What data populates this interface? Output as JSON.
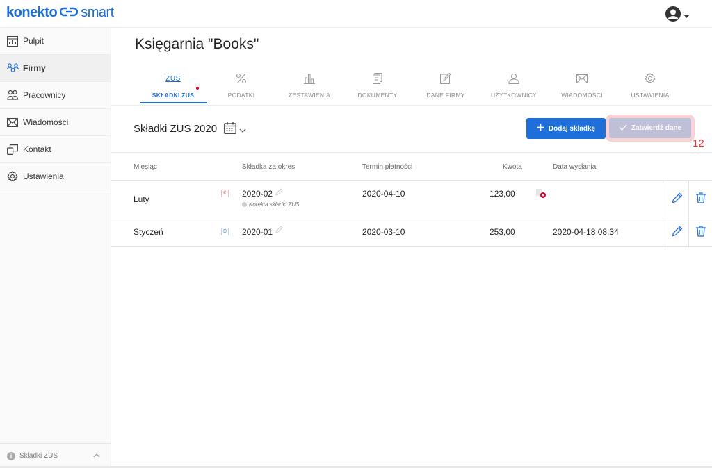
{
  "app": {
    "logo_main": "konekto",
    "logo_sub": "smart"
  },
  "sidebar": {
    "items": [
      {
        "label": "Pulpit",
        "icon": "dashboard-icon"
      },
      {
        "label": "Firmy",
        "icon": "companies-icon",
        "active": true
      },
      {
        "label": "Pracownicy",
        "icon": "employees-icon"
      },
      {
        "label": "Wiadomości",
        "icon": "mail-icon"
      },
      {
        "label": "Kontakt",
        "icon": "contact-icon"
      },
      {
        "label": "Ustawienia",
        "icon": "gear-icon"
      }
    ],
    "footer": "Składki ZUS"
  },
  "page": {
    "title": "Księgarnia \"Books\""
  },
  "tabs": [
    {
      "label": "SKŁADKI ZUS",
      "icon_text": "ZUS",
      "active": true
    },
    {
      "label": "PODATKI"
    },
    {
      "label": "ZESTAWIENIA"
    },
    {
      "label": "DOKUMENTY"
    },
    {
      "label": "DANE FIRMY"
    },
    {
      "label": "UŻYTKOWNICY"
    },
    {
      "label": "WIADOMOŚCI"
    },
    {
      "label": "USTAWIENIA"
    }
  ],
  "section": {
    "title": "Składki ZUS 2020",
    "add_button": "Dodaj składkę",
    "confirm_button": "Zatwierdź dane",
    "badge_number": "12"
  },
  "table": {
    "headers": [
      "Miesiąc",
      "Składka za okres",
      "Termin płatności",
      "Kwota",
      "Data wysłania"
    ],
    "rows": [
      {
        "month": "Luty",
        "tag": "K",
        "period": "2020-02",
        "note": "Korekta składki ZUS",
        "due": "2020-04-10",
        "amount": "123,00",
        "sent": ""
      },
      {
        "month": "Styczeń",
        "tag": "D",
        "period": "2020-01",
        "note": "",
        "due": "2020-03-10",
        "amount": "253,00",
        "sent": "2020-04-18 08:34"
      }
    ]
  },
  "colors": {
    "accent": "#1e6fd9",
    "danger": "#e4002b"
  }
}
